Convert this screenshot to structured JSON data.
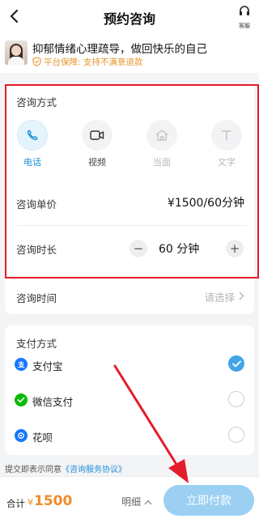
{
  "header": {
    "title": "预约咨询",
    "service_label": "客服"
  },
  "product": {
    "name": "抑郁情绪心理疏导，做回快乐的自己",
    "guarantee": "平台保障: 支持不满意退款"
  },
  "consult": {
    "title": "咨询方式",
    "options": [
      {
        "label": "电话",
        "icon": "phone-icon",
        "state": "selected"
      },
      {
        "label": "视频",
        "icon": "video-icon",
        "state": "available"
      },
      {
        "label": "当面",
        "icon": "house-icon",
        "state": "disabled"
      },
      {
        "label": "文字",
        "icon": "text-icon",
        "state": "disabled"
      }
    ],
    "price_label": "咨询单价",
    "price_value": "¥1500/60分钟",
    "duration_label": "咨询时长",
    "duration_minus": "−",
    "duration_value": "60 分钟",
    "duration_plus": "+"
  },
  "time": {
    "label": "咨询时间",
    "placeholder": "请选择"
  },
  "payment": {
    "title": "支付方式",
    "methods": [
      {
        "label": "支付宝",
        "icon": "alipay-icon",
        "color": "#1677ff",
        "selected": true
      },
      {
        "label": "微信支付",
        "icon": "wechat-pay-icon",
        "color": "#09bb07",
        "selected": false
      },
      {
        "label": "花呗",
        "icon": "huabei-icon",
        "color": "#1677ff",
        "selected": false
      }
    ]
  },
  "agreement": {
    "text": "提交即表示同意",
    "link": "《咨询服务协议》"
  },
  "footer": {
    "total_label": "合计",
    "currency": "¥",
    "total_amount": "1500",
    "detail_label": "明细",
    "pay_button": "立即付款"
  },
  "colors": {
    "accent": "#1b8fd8",
    "price_orange": "#f08b2a",
    "highlight_red": "#e41b2b",
    "pay_button": "#9bd0f3"
  }
}
